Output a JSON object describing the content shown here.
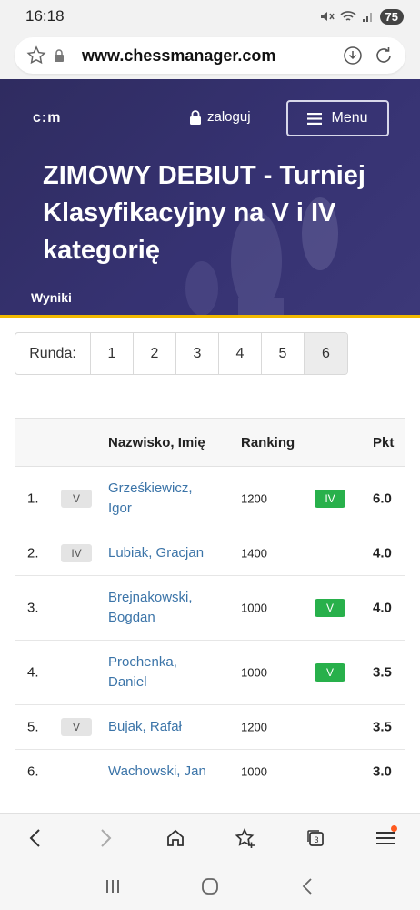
{
  "status": {
    "time": "16:18",
    "battery": "75"
  },
  "browser": {
    "url": "www.chessmanager.com"
  },
  "header": {
    "logo": "c:m",
    "login": "zaloguj",
    "menu": "Menu",
    "title": "ZIMOWY DEBIUT - Turniej Klasyfikacyjny na V i IV kategorię",
    "tab": "Wyniki"
  },
  "rounds": {
    "label": "Runda:",
    "items": [
      "1",
      "2",
      "3",
      "4",
      "5",
      "6"
    ],
    "active": "6"
  },
  "table": {
    "headers": {
      "name": "Nazwisko, Imię",
      "ranking": "Ranking",
      "points": "Pkt"
    },
    "rows": [
      {
        "pos": "1.",
        "cat": "V",
        "name": "Grześkiewicz, Igor",
        "ranking": "1200",
        "norm": "IV",
        "points": "6.0"
      },
      {
        "pos": "2.",
        "cat": "IV",
        "name": "Lubiak, Gracjan",
        "ranking": "1400",
        "norm": "",
        "points": "4.0"
      },
      {
        "pos": "3.",
        "cat": "",
        "name": "Brejnakowski, Bogdan",
        "ranking": "1000",
        "norm": "V",
        "points": "4.0"
      },
      {
        "pos": "4.",
        "cat": "",
        "name": "Prochenka, Daniel",
        "ranking": "1000",
        "norm": "V",
        "points": "3.5"
      },
      {
        "pos": "5.",
        "cat": "V",
        "name": "Bujak, Rafał",
        "ranking": "1200",
        "norm": "",
        "points": "3.5"
      },
      {
        "pos": "6.",
        "cat": "",
        "name": "Wachowski, Jan",
        "ranking": "1000",
        "norm": "",
        "points": "3.0"
      }
    ]
  },
  "colors": {
    "header_bg": "#332f6a",
    "accent": "#f2b900",
    "link": "#3b74a8",
    "norm_badge": "#28b04b"
  }
}
